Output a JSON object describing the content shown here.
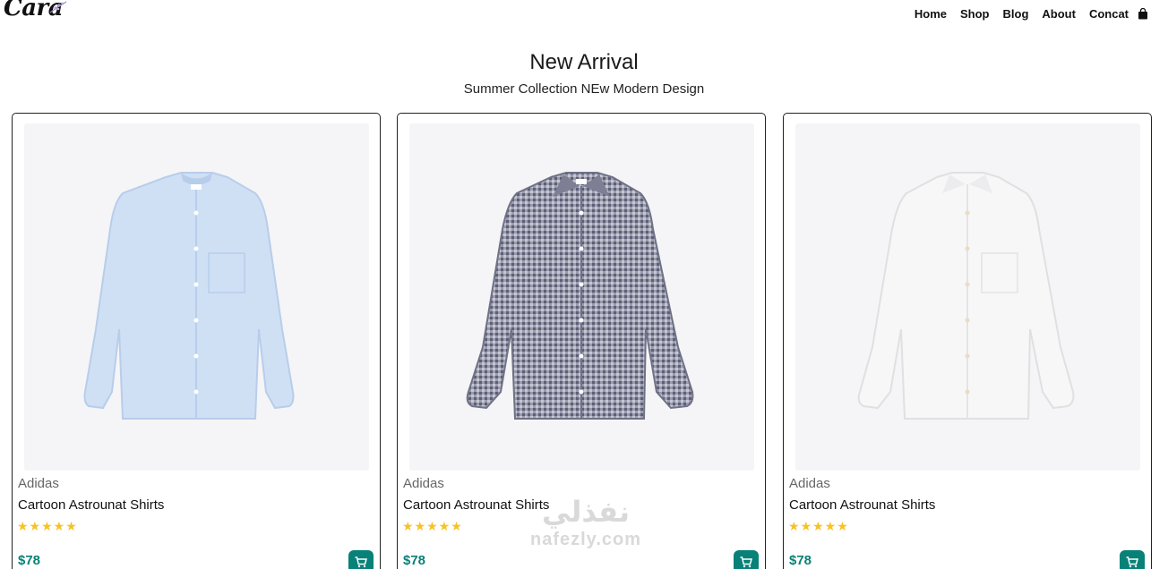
{
  "header": {
    "logo": "Cara",
    "nav": [
      "Home",
      "Shop",
      "Blog",
      "About",
      "Concat"
    ],
    "cart_icon": "shopping-bag-icon"
  },
  "section": {
    "title": "New Arrival",
    "subtitle": "Summer Collection NEw Modern Design"
  },
  "products": [
    {
      "brand": "Adidas",
      "name": "Cartoon Astrounat Shirts",
      "rating": 5,
      "stars": "★★★★★",
      "price": "$78",
      "image": "light-blue-shirt",
      "shirt_color": "#cfe0f5",
      "shirt_shade": "#b8cdea"
    },
    {
      "brand": "Adidas",
      "name": "Cartoon Astrounat Shirts",
      "rating": 5,
      "stars": "★★★★★",
      "price": "$78",
      "image": "gingham-check-shirt",
      "shirt_color": "#8b8d9f",
      "shirt_shade": "#6f7186"
    },
    {
      "brand": "Adidas",
      "name": "Cartoon Astrounat Shirts",
      "rating": 5,
      "stars": "★★★★★",
      "price": "$78",
      "image": "white-shirt",
      "shirt_color": "#f7f7f7",
      "shirt_shade": "#e4e4e6"
    }
  ],
  "colors": {
    "accent": "#088178",
    "star": "#f6c226",
    "image_bg": "#f5f5f7"
  },
  "watermark": {
    "arabic": "نفذلي",
    "latin": "nafezly.com"
  }
}
